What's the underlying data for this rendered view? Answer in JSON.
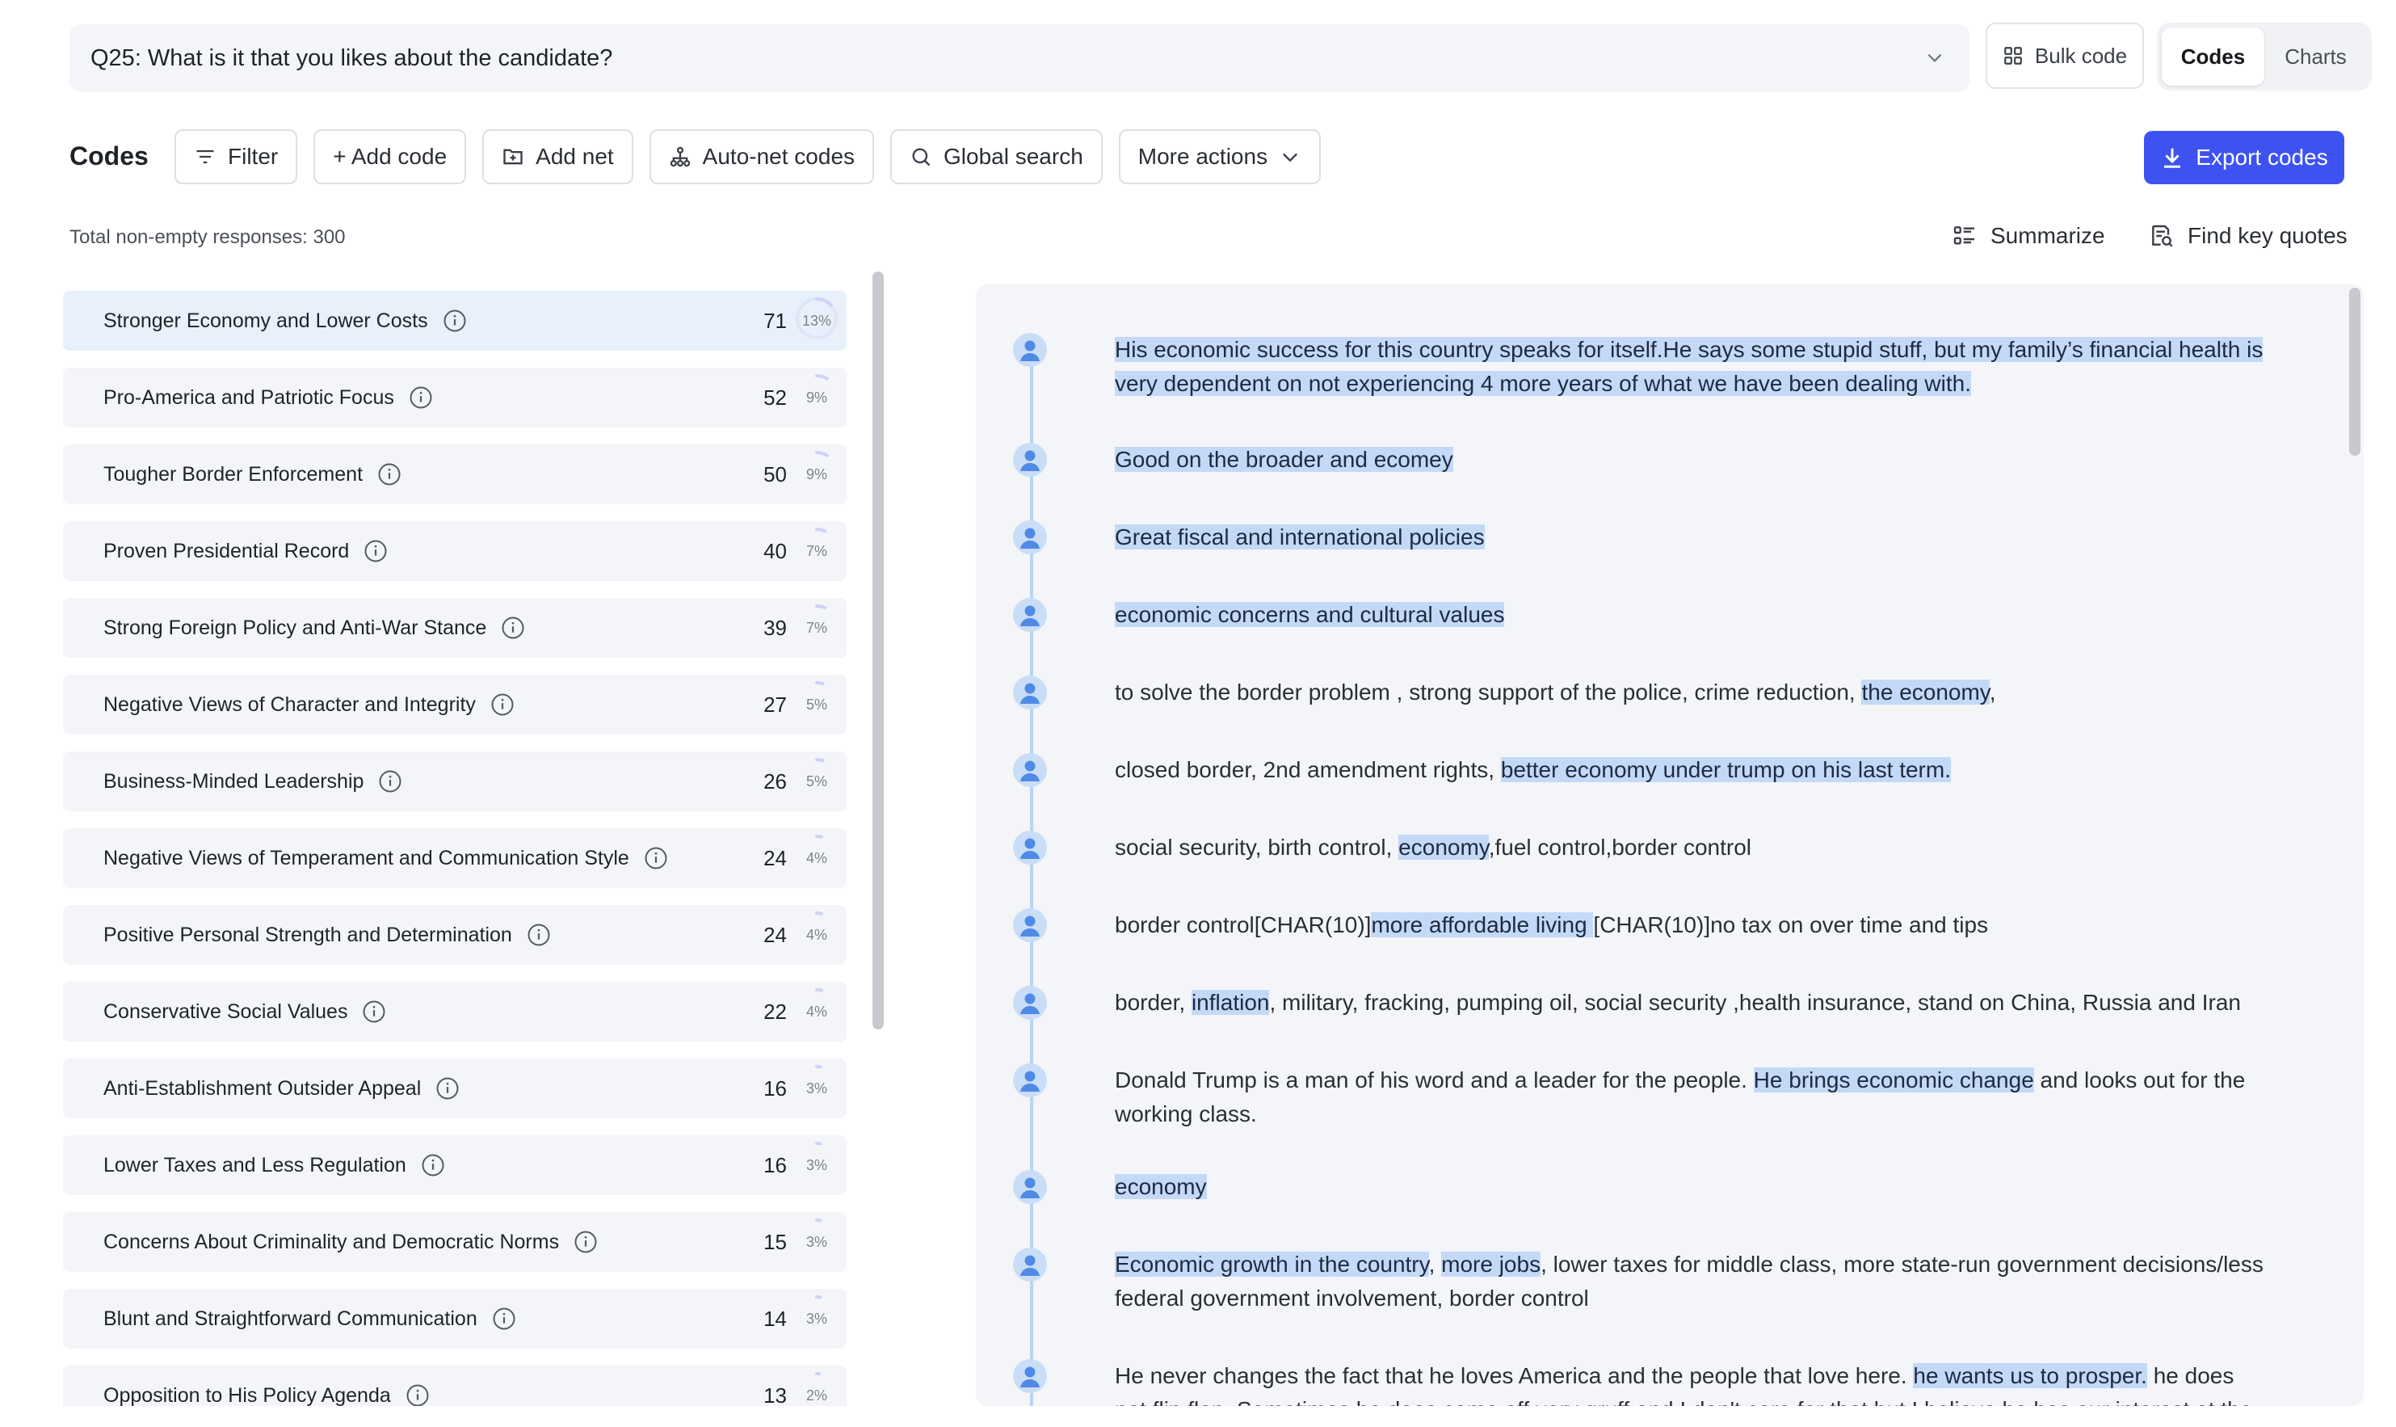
{
  "header": {
    "question": "Q25: What is it that you likes about the candidate?",
    "bulk_code_label": "Bulk code",
    "view_options": [
      "Codes",
      "Charts"
    ],
    "active_view": "Codes"
  },
  "toolbar": {
    "title": "Codes",
    "filter_label": "Filter",
    "add_code_label": "+ Add code",
    "add_net_label": "Add net",
    "auto_net_label": "Auto-net codes",
    "global_search_label": "Global search",
    "more_actions_label": "More actions",
    "export_label": "Export codes"
  },
  "summary": {
    "total_text": "Total non-empty responses: 300",
    "summarize_label": "Summarize",
    "key_quotes_label": "Find key quotes"
  },
  "codes": [
    {
      "label": "Stronger Economy and Lower Costs",
      "count": "71",
      "percent": "13%",
      "fraction": 0.13
    },
    {
      "label": "Pro-America and Patriotic Focus",
      "count": "52",
      "percent": "9%",
      "fraction": 0.09
    },
    {
      "label": "Tougher Border Enforcement",
      "count": "50",
      "percent": "9%",
      "fraction": 0.09
    },
    {
      "label": "Proven Presidential Record",
      "count": "40",
      "percent": "7%",
      "fraction": 0.07
    },
    {
      "label": "Strong Foreign Policy and Anti-War Stance",
      "count": "39",
      "percent": "7%",
      "fraction": 0.07
    },
    {
      "label": "Negative Views of Character and Integrity",
      "count": "27",
      "percent": "5%",
      "fraction": 0.05
    },
    {
      "label": "Business-Minded Leadership",
      "count": "26",
      "percent": "5%",
      "fraction": 0.05
    },
    {
      "label": "Negative Views of Temperament and Communication Style",
      "count": "24",
      "percent": "4%",
      "fraction": 0.04
    },
    {
      "label": "Positive Personal Strength and Determination",
      "count": "24",
      "percent": "4%",
      "fraction": 0.04
    },
    {
      "label": "Conservative Social Values",
      "count": "22",
      "percent": "4%",
      "fraction": 0.04
    },
    {
      "label": "Anti-Establishment Outsider Appeal",
      "count": "16",
      "percent": "3%",
      "fraction": 0.03
    },
    {
      "label": "Lower Taxes and Less Regulation",
      "count": "16",
      "percent": "3%",
      "fraction": 0.03
    },
    {
      "label": "Concerns About Criminality and Democratic Norms",
      "count": "15",
      "percent": "3%",
      "fraction": 0.03
    },
    {
      "label": "Blunt and Straightforward Communication",
      "count": "14",
      "percent": "3%",
      "fraction": 0.03
    },
    {
      "label": "Opposition to His Policy Agenda",
      "count": "13",
      "percent": "2%",
      "fraction": 0.02
    }
  ],
  "responses": [
    [
      {
        "t": "His economic success for this country speaks for itself.He says some stupid stuff, but my family’s financial health is very dependent on not experiencing 4 more years of what we have been dealing with.",
        "h": true
      }
    ],
    [
      {
        "t": "Good on the broader and ecomey",
        "h": true
      }
    ],
    [
      {
        "t": "Great fiscal and international policies",
        "h": true
      }
    ],
    [
      {
        "t": "economic concerns and cultural values",
        "h": true
      }
    ],
    [
      {
        "t": "to solve the border problem , strong support of the police, crime reduction, ",
        "h": false
      },
      {
        "t": "the economy",
        "h": true
      },
      {
        "t": ",",
        "h": false
      }
    ],
    [
      {
        "t": "closed border, 2nd amendment rights, ",
        "h": false
      },
      {
        "t": "better economy under trump on his last term.",
        "h": true
      }
    ],
    [
      {
        "t": "social security, birth control, ",
        "h": false
      },
      {
        "t": "economy",
        "h": true
      },
      {
        "t": ",fuel control,border control",
        "h": false
      }
    ],
    [
      {
        "t": "border control[CHAR(10)]",
        "h": false
      },
      {
        "t": "more affordable living ",
        "h": true
      },
      {
        "t": "[CHAR(10)]no tax on over time and tips",
        "h": false
      }
    ],
    [
      {
        "t": "border, ",
        "h": false
      },
      {
        "t": "inflation",
        "h": true
      },
      {
        "t": ", military, fracking, pumping oil, social security ,health insurance, stand on China, Russia and Iran",
        "h": false
      }
    ],
    [
      {
        "t": "Donald Trump is a man of his word and a leader for the people. ",
        "h": false
      },
      {
        "t": "He brings economic change",
        "h": true
      },
      {
        "t": " and looks out for the working class.",
        "h": false
      }
    ],
    [
      {
        "t": "economy",
        "h": true
      }
    ],
    [
      {
        "t": "Economic growth in the country",
        "h": true
      },
      {
        "t": ", ",
        "h": false
      },
      {
        "t": "more jobs",
        "h": true
      },
      {
        "t": ", lower taxes for middle class, more state-run government decisions/less federal government involvement, border control",
        "h": false
      }
    ],
    [
      {
        "t": "He never changes the fact that he loves America and the people that love here. ",
        "h": false
      },
      {
        "t": "he wants us to prosper.",
        "h": true
      },
      {
        "t": " he does not flip flop. Sometimes he does come off very gruff and I don't care for that but I believe he has our interest at the",
        "h": false
      }
    ]
  ]
}
